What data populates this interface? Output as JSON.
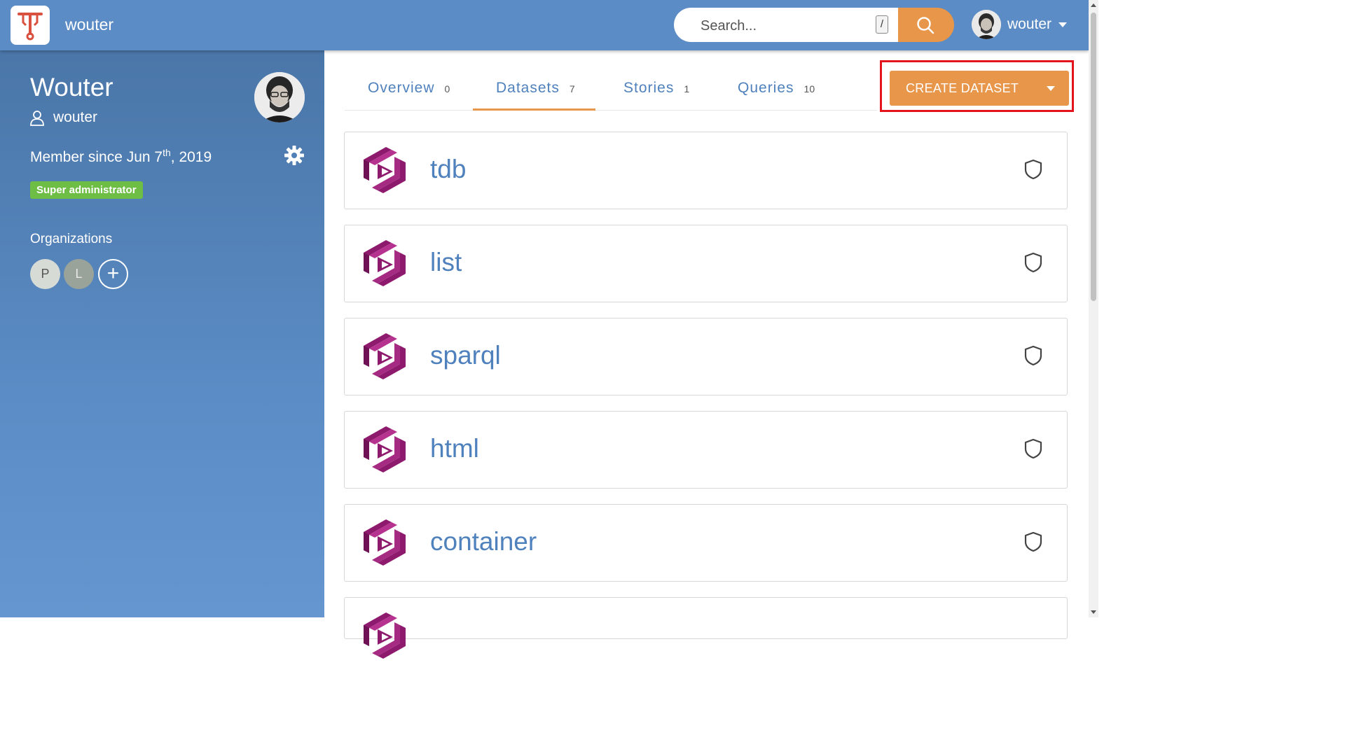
{
  "header": {
    "title": "wouter",
    "search_placeholder": "Search...",
    "search_shortcut": "/",
    "user_name": "wouter"
  },
  "sidebar": {
    "display_name": "Wouter",
    "handle": "wouter",
    "member_since_prefix": "Member since Jun 7",
    "member_since_suffix_sup": "th",
    "member_since_rest": ", 2019",
    "role_badge": "Super administrator",
    "organizations_label": "Organizations",
    "organizations": [
      "P",
      "L"
    ],
    "add_org": "+"
  },
  "tabs": [
    {
      "label": "Overview",
      "count": "0"
    },
    {
      "label": "Datasets",
      "count": "7"
    },
    {
      "label": "Stories",
      "count": "1"
    },
    {
      "label": "Queries",
      "count": "10"
    }
  ],
  "create_button": {
    "label": "CREATE DATASET"
  },
  "datasets": [
    {
      "name": "tdb"
    },
    {
      "name": "list"
    },
    {
      "name": "sparql"
    },
    {
      "name": "html"
    },
    {
      "name": "container"
    }
  ],
  "colors": {
    "header_bg": "#5b8cc5",
    "accent": "#e8964a",
    "link": "#4f81bd",
    "badge": "#6ebd45",
    "highlight": "#e3141b",
    "dataset_icon": "#8e1a6e"
  },
  "icons": {
    "search": "search-icon",
    "user": "user-icon",
    "settings": "gear-icon",
    "private": "shield-icon"
  }
}
